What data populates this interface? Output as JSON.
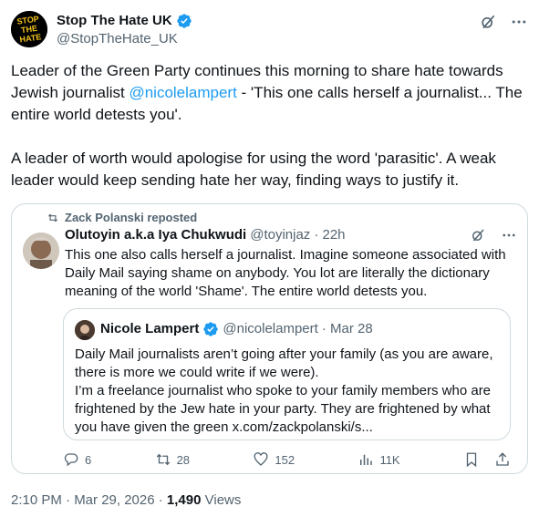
{
  "author": {
    "name": "Stop The Hate UK",
    "handle": "@StopTheHate_UK",
    "avatar_text": [
      "STOP",
      "THE",
      "HATE"
    ]
  },
  "tweet": {
    "paragraph1_pre": "Leader of the Green Party continues this morning to share hate towards Jewish journalist ",
    "mention": "@nicolelampert",
    "paragraph1_post": " - 'This one calls herself a journalist... The entire world detests you'.",
    "paragraph2": "A leader of worth would apologise for using the word 'parasitic'. A weak leader would keep sending hate her way, finding ways to justify it."
  },
  "quote": {
    "reposted_by": "Zack Polanski reposted",
    "name": "Olutoyin a.k.a Iya Chukwudi",
    "handle": "@toyinjaz",
    "time": "· 22h",
    "text": "This one also calls herself a journalist. Imagine someone associated with Daily Mail saying shame on anybody. You lot are literally the dictionary meaning of the world 'Shame'. The entire world detests you.",
    "inner": {
      "name": "Nicole Lampert",
      "handle": "@nicolelampert",
      "time": "· Mar 28",
      "text1": "Daily Mail journalists aren’t going after your family (as you are aware, there is more we could write if we were).",
      "text2": "I’m a freelance journalist who spoke to your family members who are frightened by the Jew hate in your party. They are frightened by what you have given the green x.com/zackpolanski/s..."
    },
    "metrics": {
      "replies": "6",
      "reposts": "28",
      "likes": "152",
      "views": "11K"
    }
  },
  "footer": {
    "timestamp": "2:10 PM · Mar 29, 2026 · ",
    "views_count": "1,490",
    "views_label": " Views"
  },
  "colors": {
    "accent": "#1d9bf0",
    "muted": "#536471",
    "border": "#cfd9de",
    "text": "#0f1419"
  }
}
